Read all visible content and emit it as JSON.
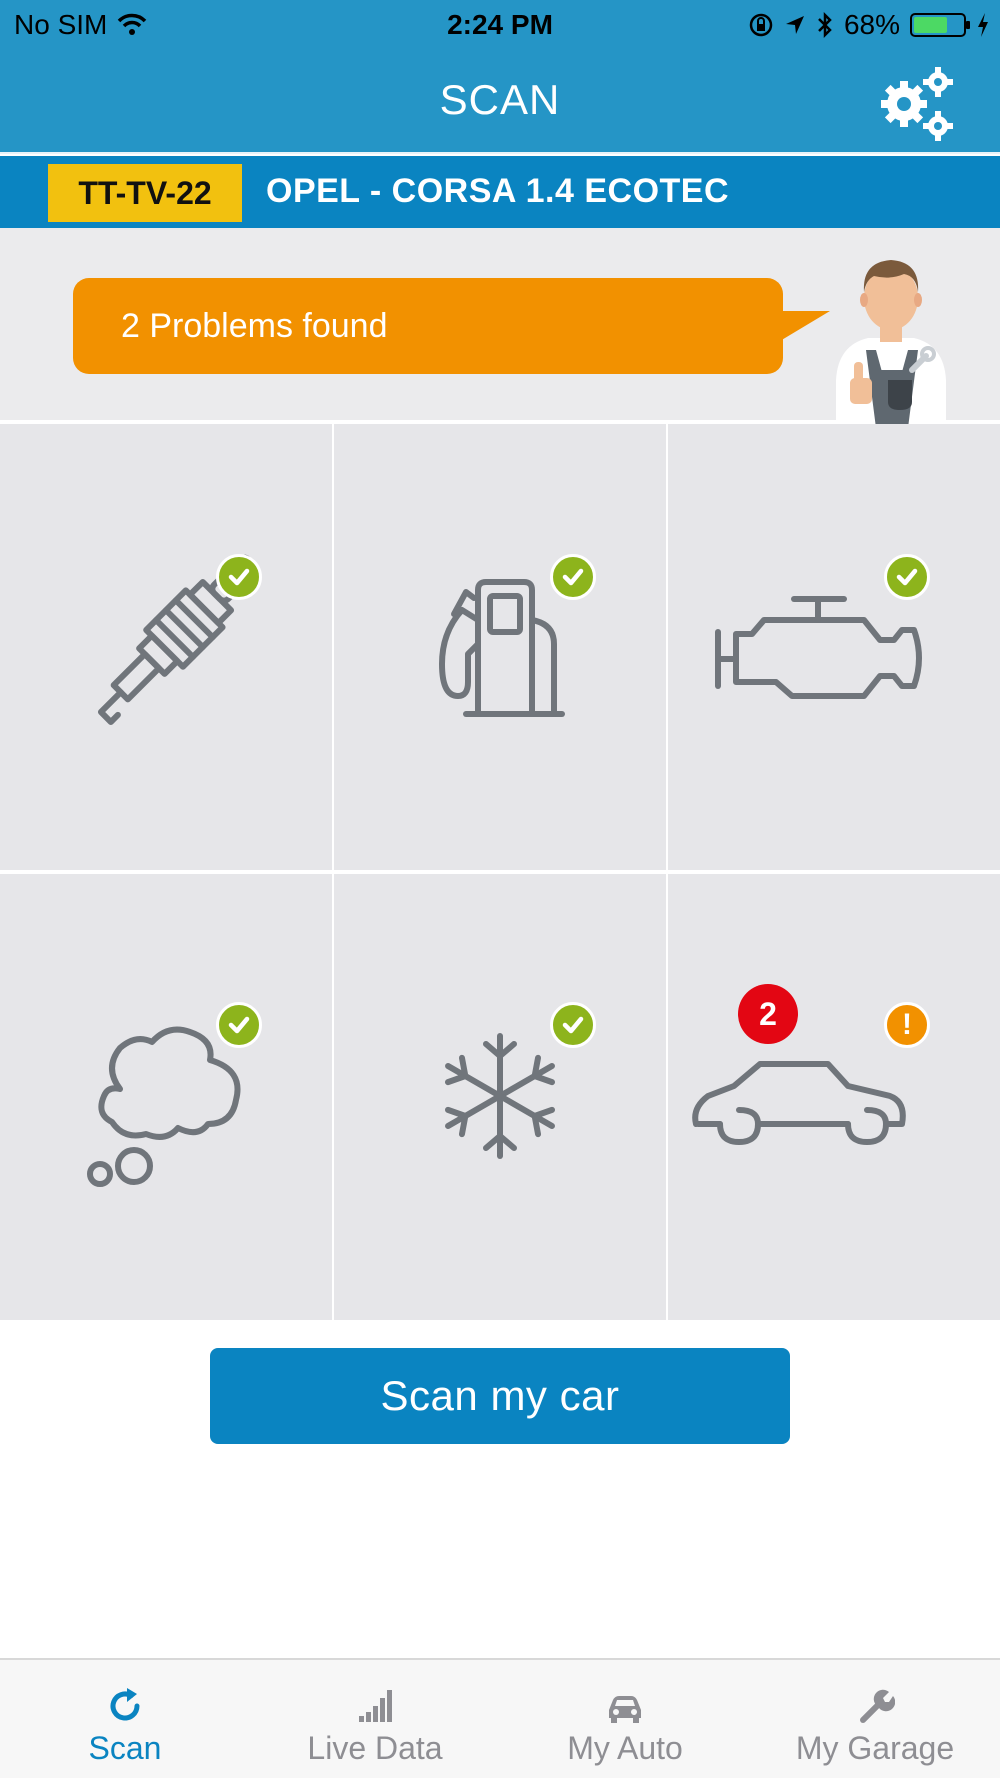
{
  "status_bar": {
    "carrier": "No SIM",
    "time": "2:24 PM",
    "battery_percent": "68%",
    "battery_level": 0.68,
    "icons": [
      "wifi-icon",
      "orientation-lock-icon",
      "location-arrow-icon",
      "bluetooth-icon",
      "battery-icon",
      "charging-bolt-icon"
    ]
  },
  "header": {
    "title": "SCAN",
    "settings_icon": "gears-icon"
  },
  "vehicle": {
    "plate": "TT-TV-22",
    "name": "OPEL - CORSA 1.4 ECOTEC"
  },
  "message": {
    "text": "2 Problems found"
  },
  "categories": [
    {
      "icon": "spark-plug-icon",
      "status": "ok"
    },
    {
      "icon": "fuel-pump-icon",
      "status": "ok"
    },
    {
      "icon": "engine-icon",
      "status": "ok"
    },
    {
      "icon": "exhaust-cloud-icon",
      "status": "ok"
    },
    {
      "icon": "snowflake-icon",
      "status": "ok"
    },
    {
      "icon": "car-body-icon",
      "status": "warning",
      "problem_count": "2",
      "warning_symbol": "!"
    }
  ],
  "scan_button": {
    "label": "Scan my car"
  },
  "tabs": [
    {
      "label": "Scan",
      "icon": "refresh-icon",
      "active": true
    },
    {
      "label": "Live Data",
      "icon": "signal-bars-icon",
      "active": false
    },
    {
      "label": "My Auto",
      "icon": "car-icon",
      "active": false
    },
    {
      "label": "My Garage",
      "icon": "wrench-icon",
      "active": false
    }
  ],
  "colors": {
    "header_blue": "#2595c6",
    "vehicle_bar_blue": "#0a84c1",
    "plate_yellow": "#f2c10f",
    "bubble_orange": "#f29100",
    "ok_green": "#8db41c",
    "count_red": "#e30613",
    "icon_gray": "#70757b"
  }
}
